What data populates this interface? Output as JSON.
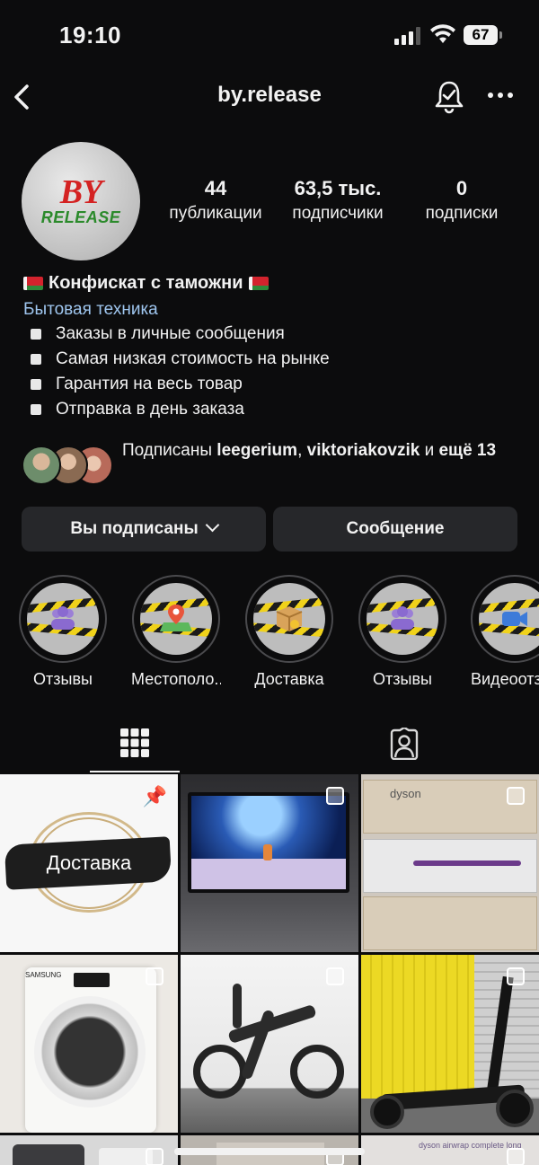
{
  "status_bar": {
    "time": "19:10",
    "battery": "67"
  },
  "nav": {
    "username": "by.release"
  },
  "avatar": {
    "line1": "BY",
    "line2": "RELEASE"
  },
  "stats": [
    {
      "value": "44",
      "label": "публикации"
    },
    {
      "value": "63,5 тыс.",
      "label": "подписчики"
    },
    {
      "value": "0",
      "label": "подписки"
    }
  ],
  "bio": {
    "name": "Конфискат с таможни",
    "category": "Бытовая техника",
    "lines": [
      "Заказы в личные сообщения",
      "Самая низкая стоимость на рынке",
      "Гарантия на весь товар",
      "Отправка в день заказа"
    ]
  },
  "followed_by": {
    "prefix": "Подписаны",
    "user1": "leegerium",
    "separator": ",",
    "user2": "viktoriakovzik",
    "and": "и",
    "more": "ещё 13"
  },
  "buttons": {
    "following": "Вы подписаны",
    "message": "Сообщение"
  },
  "highlights": [
    {
      "label": "Отзывы",
      "icon": "people-icon"
    },
    {
      "label": "Местополо...",
      "icon": "map-pin-icon"
    },
    {
      "label": "Доставка",
      "icon": "box-icon"
    },
    {
      "label": "Отзывы",
      "icon": "people-icon"
    },
    {
      "label": "Видеоотз",
      "icon": "video-camera-icon"
    }
  ],
  "posts": [
    {
      "overlay_text": "Доставка",
      "pinned": true
    },
    {
      "overlay_text": ""
    },
    {
      "overlay_text": "dyson"
    },
    {
      "overlay_text": "SAMSUNG"
    },
    {
      "overlay_text": ""
    },
    {
      "overlay_text": ""
    },
    {
      "overlay_text": ""
    },
    {
      "overlay_text": ""
    },
    {
      "overlay_text": "dyson airwrap complete long"
    }
  ],
  "colors": {
    "background": "#0c0c0d",
    "button": "#26272a",
    "link": "#9fc6ef",
    "accent_red": "#d42222",
    "accent_green": "#2b8a2b"
  }
}
